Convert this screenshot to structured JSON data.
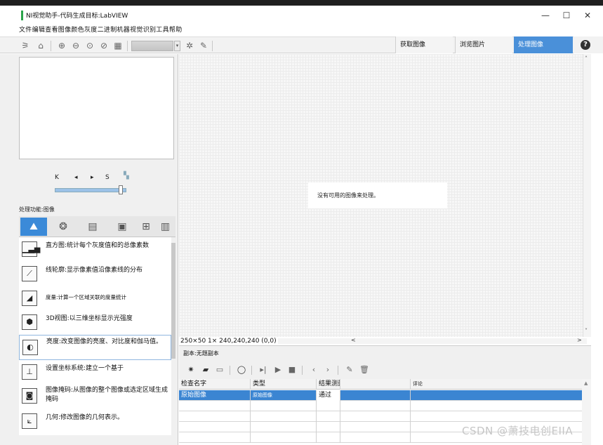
{
  "window": {
    "title": "NI视觉助手-代码生成目标:LabVIEW",
    "minimize": "—",
    "maximize": "☐",
    "close": "✕"
  },
  "menu": {
    "items_text": "文件编辑查看图像颜色灰度二进制机器视觉识别工具帮助"
  },
  "tabs": {
    "acquire": "获取图像",
    "browse": "浏览图片",
    "process": "处理图像",
    "help": "?"
  },
  "navigator": {
    "first": "K",
    "prev": "◂",
    "next": "▸",
    "last": "S",
    "slider_value": 0.95
  },
  "functions": {
    "label": "处理功能:图像",
    "items": [
      {
        "text": "直方图:统计每个灰度值和的总像素数",
        "icon": "histogram-icon"
      },
      {
        "text": "线轮廓:显示像素值沿像素线的分布",
        "icon": "line-profile-icon"
      },
      {
        "text": "度量:计算一个区域关联的度量统计",
        "icon": "measure-icon"
      },
      {
        "text": "3D视图:以三维坐标显示光强度",
        "icon": "3d-view-icon"
      },
      {
        "text": "亮度:改变图像的亮度、对比度和伽马值。",
        "icon": "brightness-icon"
      },
      {
        "text": "设置坐标系统:建立一个基于",
        "icon": "coordinate-system-icon"
      },
      {
        "text": "图像掩码:从图像的整个图像或选定区域生成掩码",
        "icon": "image-mask-icon"
      },
      {
        "text": "几何:修改图像的几何表示。",
        "icon": "geometry-icon"
      }
    ]
  },
  "canvas": {
    "message": "没有可用的图像来处理。",
    "status": "250×50 1× 240,240,240 (0,0)",
    "scroll_left": "<",
    "scroll_right": ">"
  },
  "script": {
    "title": "副本:无题副本",
    "columns": [
      "检查名字",
      "类型",
      "结果测量",
      "",
      "评论"
    ],
    "rows": [
      [
        "原始图像",
        "原始图像",
        "通过",
        "",
        ""
      ]
    ]
  },
  "watermark": "CSDN @萧技电创EIIA",
  "colors": {
    "accent": "#4a90d9",
    "selection": "#3b85d2",
    "title_accent": "#2aa44a"
  }
}
